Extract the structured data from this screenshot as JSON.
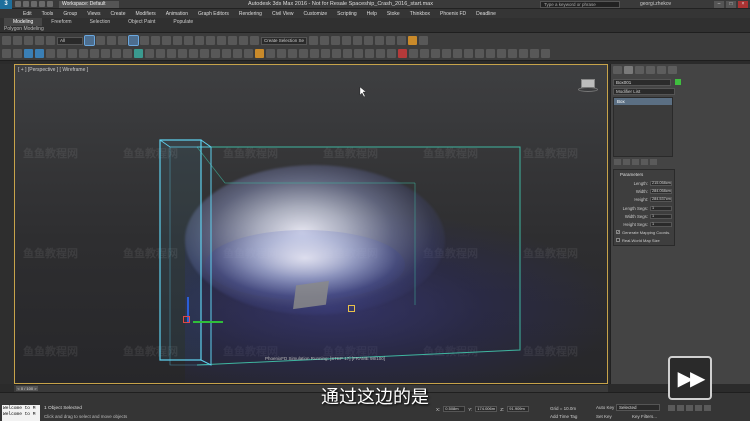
{
  "titlebar": {
    "logo": "3",
    "workspace": "Workspace: Default",
    "window_title": "Autodesk 3ds Max 2016 - Not for Resale   Spaceship_Crash_2016_start.max",
    "search_placeholder": "Type a keyword or phrase",
    "user": "georgi.zhekov",
    "minimize": "–",
    "maximize": "□",
    "close": "×"
  },
  "menus": [
    "Edit",
    "Tools",
    "Group",
    "Views",
    "Create",
    "Modifiers",
    "Animation",
    "Graph Editors",
    "Rendering",
    "Civil View",
    "Customize",
    "Scripting",
    "Help",
    "Stoke",
    "Thinkbox",
    "Phoenix FD",
    "Deadline"
  ],
  "ribbon": {
    "tabs": [
      "Modeling",
      "Freeform",
      "Selection",
      "Object Paint",
      "Populate"
    ],
    "active_tab": "Modeling",
    "sub_label": "Polygon Modeling"
  },
  "toolbar": {
    "selection_filter": "All",
    "named_selection": "Create Selection Se"
  },
  "viewport": {
    "label": "[ + ] [Perspective ] [ Wireframe ]",
    "sim_status": "PhoenixFD Simulation Running: [STEP 17] [FRAME 98/100]"
  },
  "watermark": "鱼鱼教程网",
  "command_panel": {
    "object_name": "Box001",
    "object_color": "#3fbf3f",
    "modifier_list": "Modifier List",
    "stack_item": "Box",
    "rollout_title": "Parameters",
    "params": [
      {
        "label": "Length:",
        "value": "215.058cm"
      },
      {
        "label": "Width:",
        "value": "284.058cm"
      },
      {
        "label": "Height:",
        "value": "284.537cm"
      },
      {
        "label": "Length Segs:",
        "value": "1"
      },
      {
        "label": "Width Segs:",
        "value": "1"
      },
      {
        "label": "Height Segs:",
        "value": "1"
      }
    ],
    "checks": [
      {
        "label": "Generate Mapping Coords.",
        "checked": true
      },
      {
        "label": "Real-World Map Size",
        "checked": false
      }
    ]
  },
  "subtitle": "通过这边的是",
  "play_badge": "▶▶",
  "time_slider": {
    "frame": "< 0 / 100 >"
  },
  "status": {
    "maxscript_line1": "Welcome to M",
    "maxscript_line2": "Welcome to M",
    "objects_selected": "1 Object Selected",
    "prompt": "Click and drag to select and move objects",
    "x_label": "X:",
    "x_value": "0.508m",
    "y_label": "Y:",
    "y_value": "174.006m",
    "z_label": "Z:",
    "z_value": "91.909m",
    "grid": "Grid = 10.0m",
    "add_time_tag": "Add Time Tag",
    "auto_key": "Auto Key",
    "selected": "Selected",
    "set_key": "Set Key",
    "key_filters": "Key Filters..."
  }
}
